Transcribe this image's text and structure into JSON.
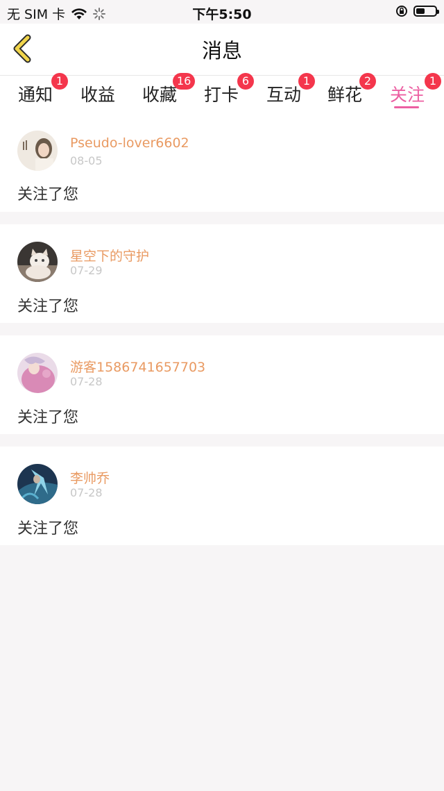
{
  "status_bar": {
    "carrier": "无 SIM 卡",
    "time": "下午5:50",
    "battery_level": 0.45,
    "icons": [
      "wifi-icon",
      "loading-spinner-icon",
      "orientation-lock-icon",
      "battery-icon"
    ]
  },
  "nav": {
    "title": "消息",
    "back_icon": "chevron-left-icon",
    "accent_color": "#f1d54b"
  },
  "tabs": [
    {
      "label": "通知",
      "badge": "1"
    },
    {
      "label": "收益",
      "badge": ""
    },
    {
      "label": "收藏",
      "badge": "16"
    },
    {
      "label": "打卡",
      "badge": "6"
    },
    {
      "label": "互动",
      "badge": "1"
    },
    {
      "label": "鲜花",
      "badge": "2"
    },
    {
      "label": "关注",
      "badge": "1",
      "active": true
    }
  ],
  "colors": {
    "active_tab": "#ec5fa2",
    "badge": "#f4364c",
    "username": "#e99a62",
    "date": "#c7c7c7"
  },
  "messages": [
    {
      "name": "Pseudo-lover6602",
      "date": "08-05",
      "text": "关注了您",
      "avatar_icon": "avatar-girl"
    },
    {
      "name": "星空下的守护",
      "date": "07-29",
      "text": "关注了您",
      "avatar_icon": "avatar-cat"
    },
    {
      "name": "游客1586741657703",
      "date": "07-28",
      "text": "关注了您",
      "avatar_icon": "avatar-anime"
    },
    {
      "name": "李帅乔",
      "date": "07-28",
      "text": "关注了您",
      "avatar_icon": "avatar-game"
    }
  ]
}
